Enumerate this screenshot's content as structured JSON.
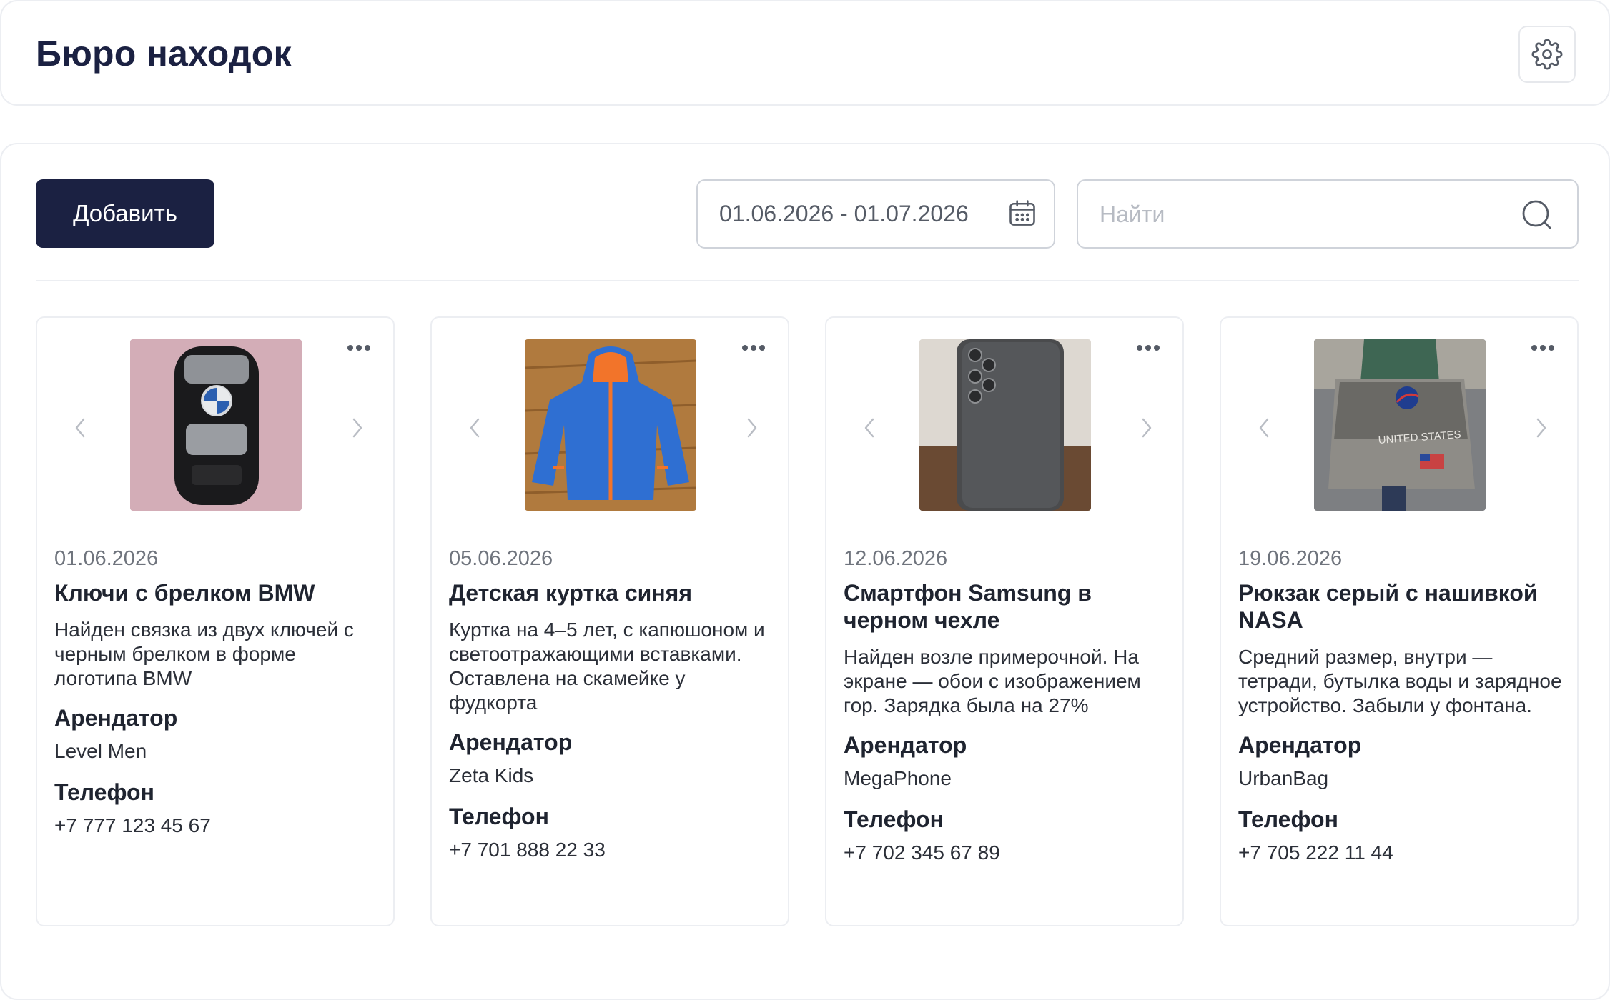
{
  "header": {
    "title": "Бюро находок",
    "settings_icon": "gear-icon"
  },
  "toolbar": {
    "add_label": "Добавить",
    "date_range": "01.06.2026 - 01.07.2026",
    "search_placeholder": "Найти",
    "search_value": ""
  },
  "colors": {
    "primary": "#1b2142",
    "border": "#cfd3da",
    "muted_text": "#6f747d"
  },
  "items": [
    {
      "date": "01.06.2026",
      "title": "Ключи с брелком BMW",
      "description": "Найден связка из двух ключей с черным брелком в форме логотипа BMW",
      "tenant_label": "Арендатор",
      "tenant": "Level Men",
      "phone_label": "Телефон",
      "phone": "+7 777 123 45 67",
      "photo": "car-key-photo"
    },
    {
      "date": "05.06.2026",
      "title": "Детская куртка синяя",
      "description": "Куртка на 4–5 лет, с капюшоном и светоотражающими вставками. Оставлена на скамейке у фудкорта",
      "tenant_label": "Арендатор",
      "tenant": "Zeta Kids",
      "phone_label": "Телефон",
      "phone": "+7 701 888 22 33",
      "photo": "jacket-photo"
    },
    {
      "date": "12.06.2026",
      "title": "Смартфон Samsung в черном чехле",
      "description": "Найден возле примерочной. На экране — обои с изображением гор. Зарядка была на 27%",
      "tenant_label": "Арендатор",
      "tenant": "MegaPhone",
      "phone_label": "Телефон",
      "phone": "+7 702 345 67 89",
      "photo": "phone-photo"
    },
    {
      "date": "19.06.2026",
      "title": "Рюкзак серый с нашивкой NASA",
      "description": "Средний размер, внутри — тетради, бутылка воды и зарядное устройство. Забыли у фонтана.",
      "tenant_label": "Арендатор",
      "tenant": "UrbanBag",
      "phone_label": "Телефон",
      "phone": "+7 705 222 11 44",
      "photo": "bag-photo",
      "photo_text": "UNITED STATES"
    }
  ]
}
